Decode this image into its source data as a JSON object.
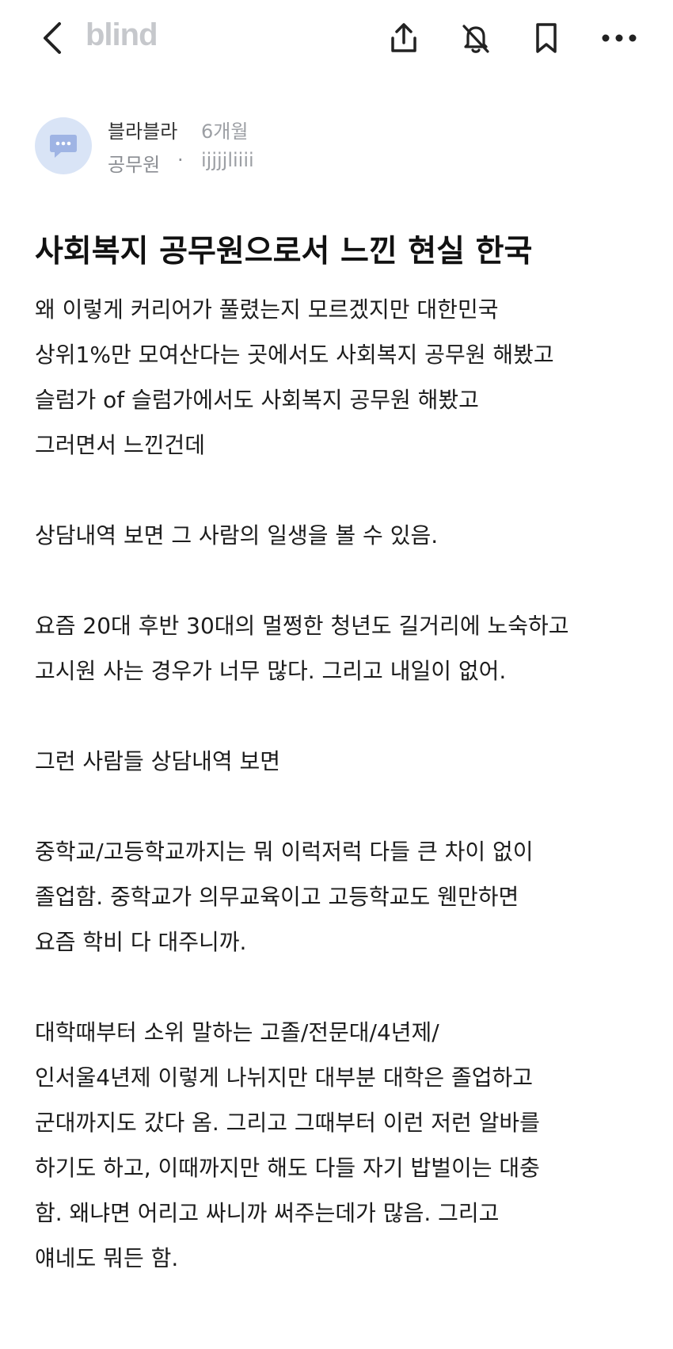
{
  "topbar": {
    "logo": "blind",
    "icons": {
      "back": "chevron-left-icon",
      "share": "share-upload-icon",
      "notifications": "bell-off-icon",
      "bookmark": "bookmark-icon",
      "more": "more-horizontal-icon"
    }
  },
  "author": {
    "avatar_icon": "chat-bubble-icon",
    "name": "블라블라",
    "time": "6개월",
    "company": "공무원",
    "separator": "·",
    "handle": "ijjjjliiii"
  },
  "post": {
    "title": "사회복지 공무원으로서 느낀 현실 한국",
    "lines": [
      "왜 이렇게 커리어가 풀렸는지 모르겠지만 대한민국",
      "상위1%만 모여산다는 곳에서도 사회복지 공무원 해봤고",
      "슬럼가 of 슬럼가에서도 사회복지 공무원 해봤고",
      "그러면서 느낀건데",
      "",
      "상담내역 보면 그 사람의 일생을 볼 수 있음.",
      "",
      "요즘 20대 후반 30대의 멀쩡한 청년도 길거리에 노숙하고",
      "고시원 사는 경우가 너무 많다. 그리고 내일이 없어.",
      "",
      "그런 사람들 상담내역 보면",
      "",
      "중학교/고등학교까지는 뭐 이럭저럭 다들 큰 차이 없이",
      "졸업함. 중학교가 의무교육이고 고등학교도 웬만하면",
      "요즘 학비 다 대주니까.",
      "",
      "대학때부터 소위 말하는 고졸/전문대/4년제/",
      "인서울4년제 이렇게 나뉘지만 대부분 대학은 졸업하고",
      "군대까지도 갔다 옴. 그리고 그때부터 이런 저런 알바를",
      "하기도 하고, 이때까지만 해도 다들 자기 밥벌이는 대충",
      "함. 왜냐면 어리고 싸니까 써주는데가 많음.  그리고",
      "얘네도 뭐든 함."
    ]
  }
}
